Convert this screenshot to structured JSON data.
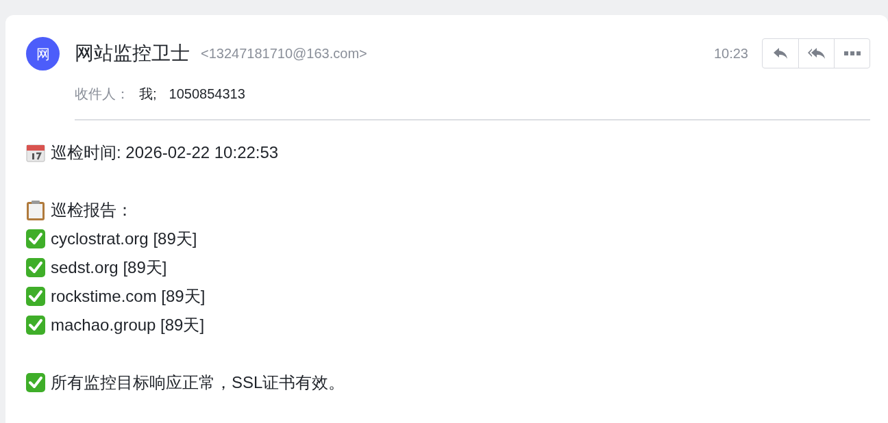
{
  "sender": {
    "avatar": "网",
    "name": "网站监控卫士",
    "address": "<13247181710@163.com>"
  },
  "time": "10:23",
  "actions": [
    {
      "kind": "reply"
    },
    {
      "kind": "reply_all"
    },
    {
      "kind": "more"
    }
  ],
  "recipients": {
    "label": "收件人：",
    "values": [
      "我;",
      "1050854313"
    ]
  },
  "body": [
    [
      {
        "kind": "calendar",
        "text": "巡检时间: 2026-02-22 10:22:53"
      }
    ],
    [
      {
        "kind": "clipboard",
        "text": "巡检报告："
      },
      {
        "kind": "check",
        "text": "cyclostrat.org [89天]"
      },
      {
        "kind": "check",
        "text": "sedst.org [89天]"
      },
      {
        "kind": "check",
        "text": "rockstime.com [89天]"
      },
      {
        "kind": "check",
        "text": "machao.group [89天]"
      }
    ],
    [
      {
        "kind": "check",
        "text": "所有监控目标响应正常，SSL证书有效。"
      }
    ]
  ]
}
